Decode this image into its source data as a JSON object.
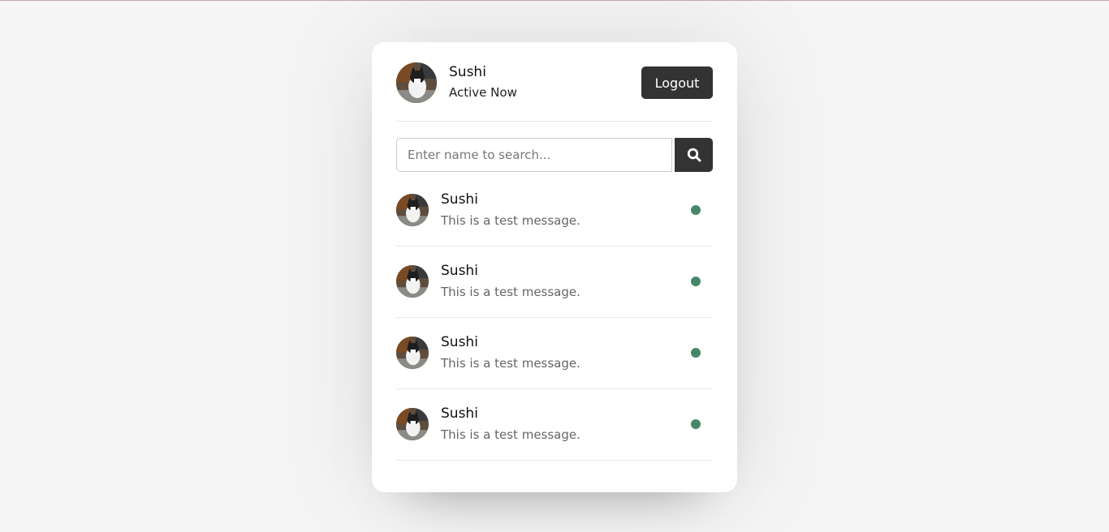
{
  "colors": {
    "background": "#f5f5f5",
    "card": "#ffffff",
    "button": "#333333",
    "online_dot": "#468669"
  },
  "header": {
    "avatar_icon": "cat-photo-avatar",
    "name": "Sushi",
    "status": "Active Now",
    "logout_label": "Logout"
  },
  "search": {
    "placeholder": "Enter name to search...",
    "value": "",
    "button_icon": "search-icon"
  },
  "users": [
    {
      "name": "Sushi",
      "message": "This is a test message.",
      "status": "online"
    },
    {
      "name": "Sushi",
      "message": "This is a test message.",
      "status": "online"
    },
    {
      "name": "Sushi",
      "message": "This is a test message.",
      "status": "online"
    },
    {
      "name": "Sushi",
      "message": "This is a test message.",
      "status": "online"
    }
  ]
}
